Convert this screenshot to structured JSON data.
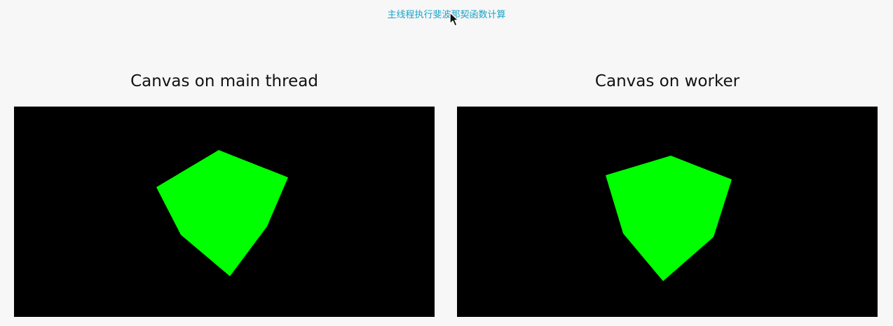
{
  "header": {
    "link_label": "主线程执行斐波那契函数计算"
  },
  "panels": [
    {
      "title": "Canvas on main thread"
    },
    {
      "title": "Canvas on worker"
    }
  ],
  "colors": {
    "page_background": "#f7f7f7",
    "link": "#1aa3c8",
    "canvas_background": "#000000",
    "cube": "#00ff00",
    "title_text": "#111111"
  },
  "icons": {
    "cursor": "mouse-pointer-icon"
  }
}
